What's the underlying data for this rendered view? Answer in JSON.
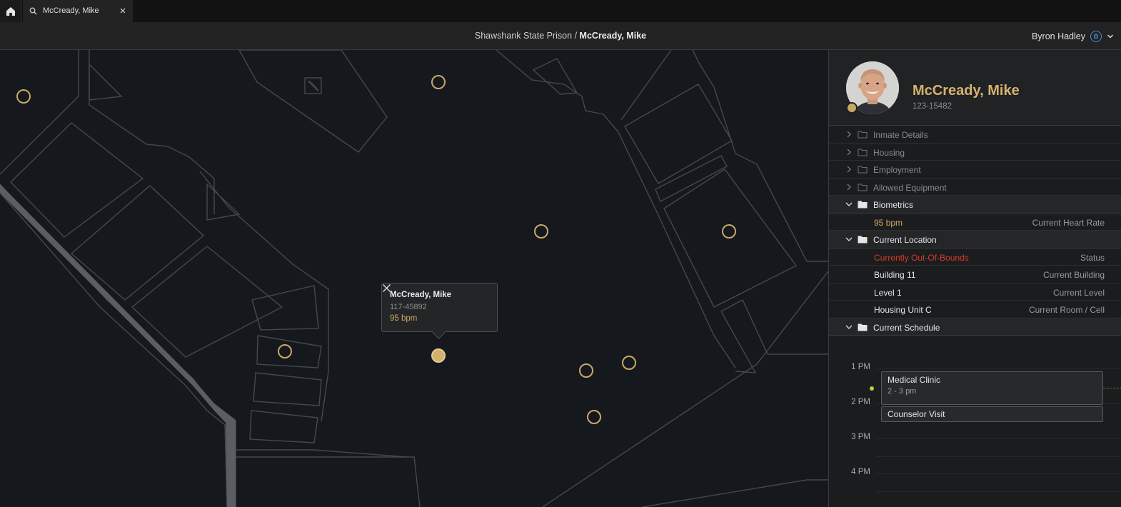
{
  "tabs": {
    "home_icon": "home-icon",
    "active_tab": {
      "label": "McCready, Mike",
      "icon": "search-icon"
    }
  },
  "header": {
    "breadcrumb_parent": "Shawshank State Prison",
    "breadcrumb_separator": "/",
    "breadcrumb_current": "McCready, Mike",
    "user_name": "Byron Hadley",
    "user_initial": "B"
  },
  "map": {
    "popup": {
      "name": "McCready, Mike",
      "id": "117-45892",
      "bpm": "95 bpm"
    }
  },
  "profile": {
    "name": "McCready, Mike",
    "id": "123-15482"
  },
  "sections": {
    "inmate_details": "Inmate Details",
    "housing": "Housing",
    "employment": "Employment",
    "allowed_equipment": "Allowed Equipment",
    "biometrics": "Biometrics",
    "biometrics_rows": [
      {
        "value": "95 bpm",
        "key": "Current Heart Rate"
      }
    ],
    "current_location": "Current Location",
    "location_rows": [
      {
        "value": "Currently Out-Of-Bounds",
        "key": "Status"
      },
      {
        "value": "Building 11",
        "key": "Current Building"
      },
      {
        "value": "Level 1",
        "key": "Current Level"
      },
      {
        "value": "Housing Unit C",
        "key": "Current Room / Cell"
      }
    ],
    "current_schedule": "Current Schedule"
  },
  "schedule": {
    "times": [
      "1 PM",
      "2 PM",
      "3 PM",
      "4 PM"
    ],
    "events": [
      {
        "title": "Medical Clinic",
        "time": "2 - 3 pm"
      },
      {
        "title": "Counselor Visit",
        "time": ""
      }
    ]
  },
  "colors": {
    "accent_gold": "#d7b36f",
    "alert_red": "#d93a2b",
    "now_indicator": "#b7d43a",
    "user_blue": "#4a8fd8"
  }
}
